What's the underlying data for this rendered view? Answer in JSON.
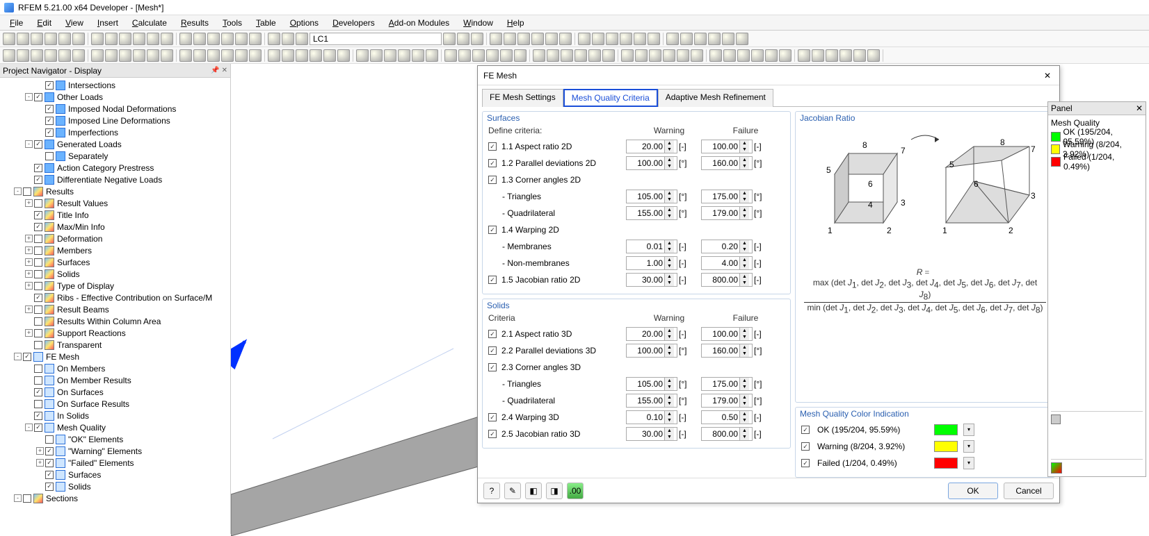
{
  "window": {
    "title": "RFEM 5.21.00 x64 Developer - [Mesh*]"
  },
  "menu": [
    "File",
    "Edit",
    "View",
    "Insert",
    "Calculate",
    "Results",
    "Tools",
    "Table",
    "Options",
    "Developers",
    "Add-on Modules",
    "Window",
    "Help"
  ],
  "lc_dropdown": "LC1",
  "navigator": {
    "title": "Project Navigator - Display",
    "items": [
      {
        "depth": 3,
        "exp": "",
        "cb": true,
        "icon": "blue",
        "label": "Intersections"
      },
      {
        "depth": 2,
        "exp": "-",
        "cb": true,
        "icon": "blue",
        "label": "Other Loads"
      },
      {
        "depth": 3,
        "exp": "",
        "cb": true,
        "icon": "blue",
        "label": "Imposed Nodal Deformations"
      },
      {
        "depth": 3,
        "exp": "",
        "cb": true,
        "icon": "blue",
        "label": "Imposed Line Deformations"
      },
      {
        "depth": 3,
        "exp": "",
        "cb": true,
        "icon": "blue",
        "label": "Imperfections"
      },
      {
        "depth": 2,
        "exp": "-",
        "cb": true,
        "icon": "blue",
        "label": "Generated Loads"
      },
      {
        "depth": 3,
        "exp": "",
        "cb": false,
        "icon": "blue",
        "label": "Separately"
      },
      {
        "depth": 2,
        "exp": "",
        "cb": true,
        "icon": "blue",
        "label": "Action Category Prestress"
      },
      {
        "depth": 2,
        "exp": "",
        "cb": true,
        "icon": "blue",
        "label": "Differentiate Negative Loads"
      },
      {
        "depth": 1,
        "exp": "-",
        "cb": false,
        "icon": "gradient",
        "label": "Results"
      },
      {
        "depth": 2,
        "exp": "+",
        "cb": false,
        "icon": "gradient",
        "label": "Result Values"
      },
      {
        "depth": 2,
        "exp": "",
        "cb": true,
        "icon": "gradient",
        "label": "Title Info"
      },
      {
        "depth": 2,
        "exp": "",
        "cb": true,
        "icon": "gradient",
        "label": "Max/Min Info"
      },
      {
        "depth": 2,
        "exp": "+",
        "cb": false,
        "icon": "gradient",
        "label": "Deformation"
      },
      {
        "depth": 2,
        "exp": "+",
        "cb": false,
        "icon": "gradient",
        "label": "Members"
      },
      {
        "depth": 2,
        "exp": "+",
        "cb": false,
        "icon": "gradient",
        "label": "Surfaces"
      },
      {
        "depth": 2,
        "exp": "+",
        "cb": false,
        "icon": "gradient",
        "label": "Solids"
      },
      {
        "depth": 2,
        "exp": "+",
        "cb": false,
        "icon": "gradient",
        "label": "Type of Display"
      },
      {
        "depth": 2,
        "exp": "",
        "cb": true,
        "icon": "gradient",
        "label": "Ribs - Effective Contribution on Surface/M"
      },
      {
        "depth": 2,
        "exp": "+",
        "cb": false,
        "icon": "gradient",
        "label": "Result Beams"
      },
      {
        "depth": 2,
        "exp": "",
        "cb": false,
        "icon": "gradient",
        "label": "Results Within Column Area"
      },
      {
        "depth": 2,
        "exp": "+",
        "cb": false,
        "icon": "gradient",
        "label": "Support Reactions"
      },
      {
        "depth": 2,
        "exp": "",
        "cb": false,
        "icon": "gradient",
        "label": "Transparent"
      },
      {
        "depth": 1,
        "exp": "-",
        "cb": true,
        "icon": "mesh",
        "label": "FE Mesh"
      },
      {
        "depth": 2,
        "exp": "",
        "cb": false,
        "icon": "mesh",
        "label": "On Members"
      },
      {
        "depth": 2,
        "exp": "",
        "cb": false,
        "icon": "mesh",
        "label": "On Member Results"
      },
      {
        "depth": 2,
        "exp": "",
        "cb": true,
        "icon": "mesh",
        "label": "On Surfaces"
      },
      {
        "depth": 2,
        "exp": "",
        "cb": false,
        "icon": "mesh",
        "label": "On Surface Results"
      },
      {
        "depth": 2,
        "exp": "",
        "cb": true,
        "icon": "mesh",
        "label": "In Solids"
      },
      {
        "depth": 2,
        "exp": "-",
        "cb": true,
        "icon": "mesh",
        "label": "Mesh Quality"
      },
      {
        "depth": 3,
        "exp": "",
        "cb": false,
        "icon": "mesh",
        "label": "\"OK\" Elements"
      },
      {
        "depth": 3,
        "exp": "+",
        "cb": true,
        "icon": "mesh",
        "label": "\"Warning\" Elements"
      },
      {
        "depth": 3,
        "exp": "+",
        "cb": true,
        "icon": "mesh",
        "label": "\"Failed\" Elements"
      },
      {
        "depth": 3,
        "exp": "",
        "cb": true,
        "icon": "mesh",
        "label": "Surfaces"
      },
      {
        "depth": 3,
        "exp": "",
        "cb": true,
        "icon": "mesh",
        "label": "Solids"
      },
      {
        "depth": 1,
        "exp": "-",
        "cb": false,
        "icon": "gradient",
        "label": "Sections"
      }
    ]
  },
  "dialog": {
    "title": "FE Mesh",
    "tabs": [
      "FE Mesh Settings",
      "Mesh Quality Criteria",
      "Adaptive Mesh Refinement"
    ],
    "active_tab": 1,
    "surfaces": {
      "title": "Surfaces",
      "head": {
        "c1": "Define criteria:",
        "c2": "Warning",
        "c3": "Failure"
      },
      "rows": [
        {
          "cb": true,
          "label": "1.1 Aspect ratio 2D",
          "warn": "20.00",
          "fail": "100.00",
          "unit": "[-]",
          "indent": false
        },
        {
          "cb": true,
          "label": "1.2 Parallel deviations 2D",
          "warn": "100.00",
          "fail": "160.00",
          "unit": "[°]",
          "indent": false
        },
        {
          "cb": true,
          "label": "1.3 Corner angles 2D",
          "warn": "",
          "fail": "",
          "unit": "",
          "indent": false
        },
        {
          "cb": null,
          "label": "- Triangles",
          "warn": "105.00",
          "fail": "175.00",
          "unit": "[°]",
          "indent": true
        },
        {
          "cb": null,
          "label": "- Quadrilateral",
          "warn": "155.00",
          "fail": "179.00",
          "unit": "[°]",
          "indent": true
        },
        {
          "cb": true,
          "label": "1.4 Warping 2D",
          "warn": "",
          "fail": "",
          "unit": "",
          "indent": false
        },
        {
          "cb": null,
          "label": "- Membranes",
          "warn": "0.01",
          "fail": "0.20",
          "unit": "[-]",
          "indent": true
        },
        {
          "cb": null,
          "label": "- Non-membranes",
          "warn": "1.00",
          "fail": "4.00",
          "unit": "[-]",
          "indent": true
        },
        {
          "cb": true,
          "label": "1.5 Jacobian ratio 2D",
          "warn": "30.00",
          "fail": "800.00",
          "unit": "[-]",
          "indent": false
        }
      ]
    },
    "solids": {
      "title": "Solids",
      "head": {
        "c1": "Criteria",
        "c2": "Warning",
        "c3": "Failure"
      },
      "rows": [
        {
          "cb": true,
          "label": "2.1 Aspect ratio 3D",
          "warn": "20.00",
          "fail": "100.00",
          "unit": "[-]",
          "indent": false
        },
        {
          "cb": true,
          "label": "2.2 Parallel deviations 3D",
          "warn": "100.00",
          "fail": "160.00",
          "unit": "[°]",
          "indent": false
        },
        {
          "cb": true,
          "label": "2.3 Corner angles 3D",
          "warn": "",
          "fail": "",
          "unit": "",
          "indent": false
        },
        {
          "cb": null,
          "label": "- Triangles",
          "warn": "105.00",
          "fail": "175.00",
          "unit": "[°]",
          "indent": true
        },
        {
          "cb": null,
          "label": "- Quadrilateral",
          "warn": "155.00",
          "fail": "179.00",
          "unit": "[°]",
          "indent": true
        },
        {
          "cb": true,
          "label": "2.4 Warping 3D",
          "warn": "0.10",
          "fail": "0.50",
          "unit": "[-]",
          "indent": false
        },
        {
          "cb": true,
          "label": "2.5 Jacobian ratio 3D",
          "warn": "30.00",
          "fail": "800.00",
          "unit": "[-]",
          "indent": false
        }
      ]
    },
    "jacobian": {
      "title": "Jacobian Ratio"
    },
    "color_ind": {
      "title": "Mesh Quality Color Indication",
      "rows": [
        {
          "cb": true,
          "label": "OK (195/204, 95.59%)",
          "color": "green"
        },
        {
          "cb": true,
          "label": "Warning (8/204, 3.92%)",
          "color": "yellow"
        },
        {
          "cb": true,
          "label": "Failed (1/204, 0.49%)",
          "color": "red"
        }
      ]
    },
    "ok": "OK",
    "cancel": "Cancel"
  },
  "panel": {
    "title": "Panel",
    "section": "Mesh Quality",
    "rows": [
      {
        "color": "green",
        "label": "OK (195/204, 95.59%)"
      },
      {
        "color": "yellow",
        "label": "Warning (8/204, 3.92%)"
      },
      {
        "color": "red",
        "label": "Failed (1/204, 0.49%)"
      }
    ]
  }
}
